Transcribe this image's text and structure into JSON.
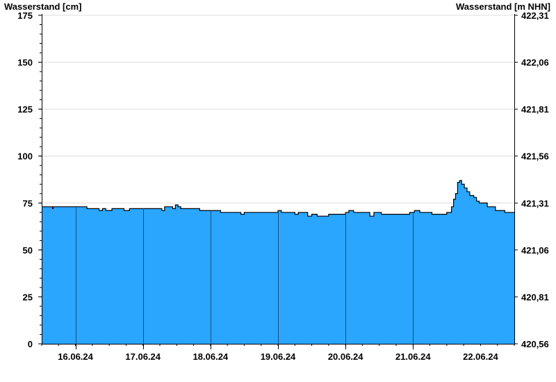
{
  "chart_data": {
    "type": "area",
    "ylabel_left": "Wasserstand [cm]",
    "ylabel_right": "Wasserstand [m NHN]",
    "y_left_ticks": [
      "0",
      "25",
      "50",
      "75",
      "100",
      "125",
      "150",
      "175"
    ],
    "y_right_ticks": [
      "420,56",
      "420,81",
      "421,06",
      "421,31",
      "421,56",
      "421,81",
      "422,06",
      "422,31"
    ],
    "ylim": [
      0,
      175
    ],
    "x_ticks": [
      "16.06.24",
      "17.06.24",
      "18.06.24",
      "19.06.24",
      "20.06.24",
      "21.06.24",
      "22.06.24"
    ],
    "x_start": "15.06.24 12:00",
    "x_end": "22.06.24 12:00",
    "grid": true,
    "fill_color": "#2aa6ff",
    "series": [
      {
        "values": [
          [
            0.0,
            73
          ],
          [
            0.15,
            73
          ],
          [
            0.16,
            72
          ],
          [
            0.17,
            73
          ],
          [
            0.66,
            73
          ],
          [
            0.67,
            72
          ],
          [
            0.82,
            72
          ],
          [
            0.85,
            71
          ],
          [
            0.9,
            72
          ],
          [
            0.95,
            71
          ],
          [
            1.0,
            71
          ],
          [
            1.04,
            72
          ],
          [
            1.16,
            72
          ],
          [
            1.22,
            71
          ],
          [
            1.3,
            72
          ],
          [
            1.72,
            72
          ],
          [
            1.78,
            71
          ],
          [
            1.82,
            73
          ],
          [
            1.9,
            73
          ],
          [
            1.94,
            72
          ],
          [
            1.98,
            74
          ],
          [
            2.02,
            73
          ],
          [
            2.06,
            72
          ],
          [
            2.3,
            72
          ],
          [
            2.34,
            71
          ],
          [
            2.6,
            71
          ],
          [
            2.65,
            70
          ],
          [
            2.9,
            70
          ],
          [
            2.95,
            69
          ],
          [
            3.0,
            70
          ],
          [
            3.45,
            70
          ],
          [
            3.5,
            71
          ],
          [
            3.55,
            70
          ],
          [
            3.7,
            70
          ],
          [
            3.75,
            69
          ],
          [
            3.8,
            70
          ],
          [
            3.9,
            70
          ],
          [
            3.94,
            68
          ],
          [
            4.0,
            69
          ],
          [
            4.08,
            68
          ],
          [
            4.2,
            68
          ],
          [
            4.25,
            69
          ],
          [
            4.45,
            69
          ],
          [
            4.5,
            70
          ],
          [
            4.55,
            71
          ],
          [
            4.62,
            70
          ],
          [
            4.8,
            70
          ],
          [
            4.86,
            68
          ],
          [
            4.92,
            70
          ],
          [
            5.0,
            70
          ],
          [
            5.03,
            69
          ],
          [
            5.4,
            69
          ],
          [
            5.45,
            70
          ],
          [
            5.52,
            71
          ],
          [
            5.6,
            70
          ],
          [
            5.75,
            70
          ],
          [
            5.78,
            69
          ],
          [
            5.98,
            69
          ],
          [
            6.0,
            70
          ],
          [
            6.04,
            70
          ],
          [
            6.07,
            73
          ],
          [
            6.1,
            77
          ],
          [
            6.13,
            80
          ],
          [
            6.16,
            86
          ],
          [
            6.19,
            87
          ],
          [
            6.22,
            85
          ],
          [
            6.26,
            83
          ],
          [
            6.3,
            81
          ],
          [
            6.34,
            79
          ],
          [
            6.4,
            78
          ],
          [
            6.44,
            76
          ],
          [
            6.48,
            75
          ],
          [
            6.56,
            75
          ],
          [
            6.6,
            73
          ],
          [
            6.68,
            73
          ],
          [
            6.72,
            71
          ],
          [
            6.82,
            71
          ],
          [
            6.86,
            70
          ],
          [
            7.0,
            70
          ]
        ]
      }
    ]
  }
}
